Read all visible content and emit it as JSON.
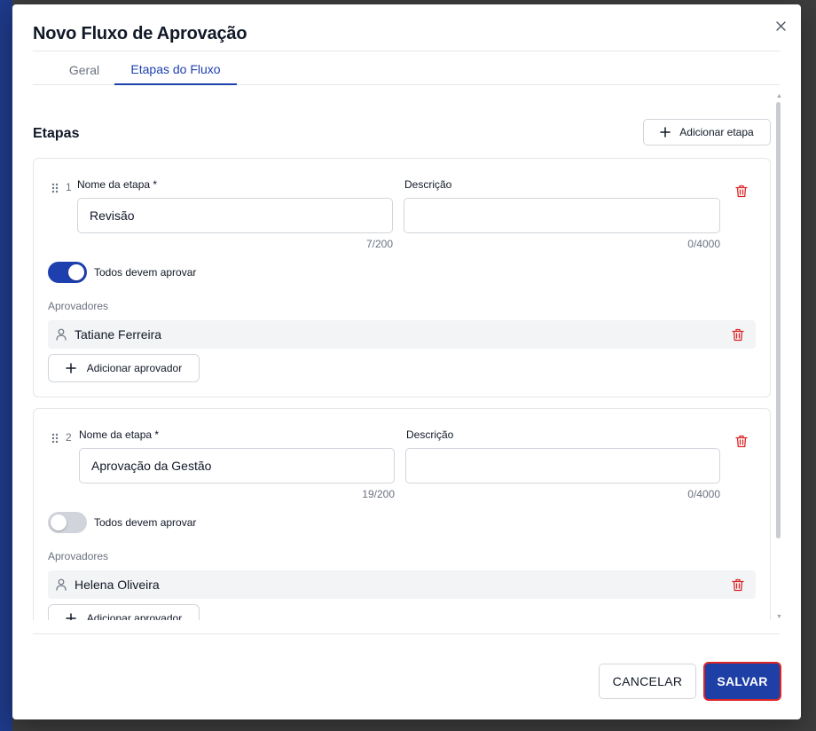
{
  "modal": {
    "title": "Novo Fluxo de Aprovação",
    "close_icon": "close-icon"
  },
  "tabs": [
    {
      "label": "Geral",
      "active": false
    },
    {
      "label": "Etapas do Fluxo",
      "active": true
    }
  ],
  "section": {
    "title": "Etapas",
    "add_step_label": "Adicionar etapa"
  },
  "steps": [
    {
      "number": "1",
      "name_label": "Nome da etapa *",
      "name_value": "Revisão",
      "name_count": "7/200",
      "description_label": "Descrição",
      "description_value": "",
      "description_count": "0/4000",
      "all_must_approve": true,
      "toggle_label": "Todos devem aprovar",
      "approvers_label": "Aprovadores",
      "approvers": [
        {
          "name": "Tatiane Ferreira"
        }
      ],
      "add_approver_label": "Adicionar aprovador"
    },
    {
      "number": "2",
      "name_label": "Nome da etapa *",
      "name_value": "Aprovação da Gestão",
      "name_count": "19/200",
      "description_label": "Descrição",
      "description_value": "",
      "description_count": "0/4000",
      "all_must_approve": false,
      "toggle_label": "Todos devem aprovar",
      "approvers_label": "Aprovadores",
      "approvers": [
        {
          "name": "Helena Oliveira"
        }
      ],
      "add_approver_label": "Adicionar aprovador"
    }
  ],
  "footer": {
    "cancel_label": "CANCELAR",
    "save_label": "SALVAR"
  },
  "colors": {
    "primary": "#1e40af",
    "danger": "#dc2626",
    "border": "#d1d5db"
  }
}
